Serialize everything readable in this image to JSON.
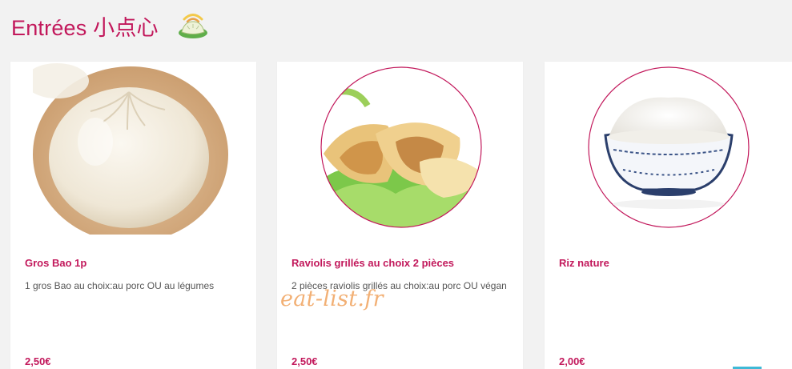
{
  "section": {
    "title": "Entrées 小点心",
    "icon": "dumpling-icon"
  },
  "products": [
    {
      "name": "Gros Bao 1p",
      "description": "1 gros Bao au choix:au porc OU au légumes",
      "price": "2,50€",
      "image": "steamed-bun-image"
    },
    {
      "name": "Raviolis grillés au choix 2 pièces",
      "description": "2 pièces raviolis grillés au choix:au porc OU végan",
      "price": "2,50€",
      "image": "grilled-dumplings-image"
    },
    {
      "name": "Riz nature",
      "description": "",
      "price": "2,00€",
      "image": "rice-bowl-image"
    }
  ],
  "watermark": "eat-list.fr",
  "colors": {
    "accent": "#c2185b",
    "background": "#f2f2f2",
    "card": "#ffffff",
    "text": "#555555",
    "watermark": "#f0a35e",
    "add_strip": "#3fb9d6"
  }
}
